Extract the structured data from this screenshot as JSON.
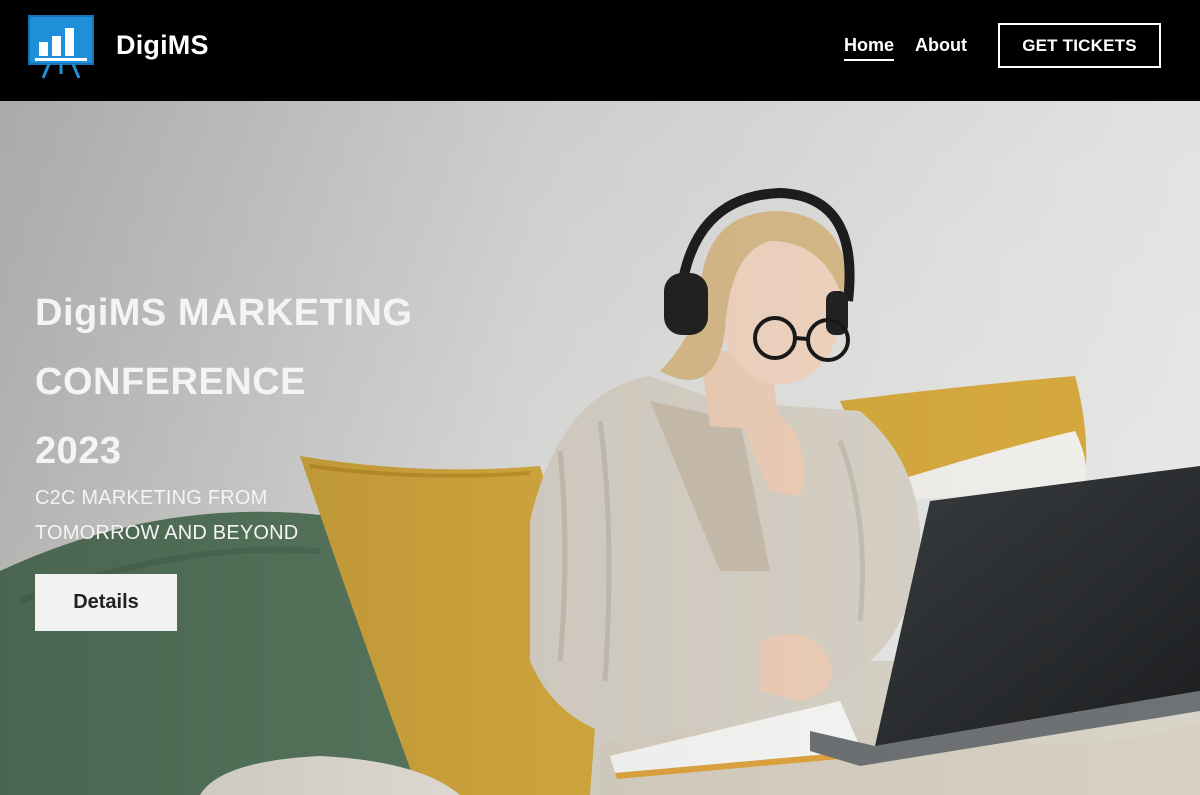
{
  "header": {
    "brand": "DigiMS",
    "logo_icon": "presentation-board-icon",
    "nav": {
      "home": "Home",
      "about": "About"
    },
    "cta": "GET TICKETS"
  },
  "hero": {
    "title_lines": [
      "DigiMS MARKETING",
      "CONFERENCE",
      "2023"
    ],
    "subtitle_lines": [
      "C2C MARKETING FROM",
      "TOMORROW AND BEYOND"
    ],
    "button": "Details",
    "image_description_icon": "woman-with-laptop-photo"
  },
  "colors": {
    "header_bg": "#000000",
    "logo_blue": "#1e8fd8",
    "hero_text": "#f4f4f4",
    "button_bg": "#f2f2f2"
  }
}
